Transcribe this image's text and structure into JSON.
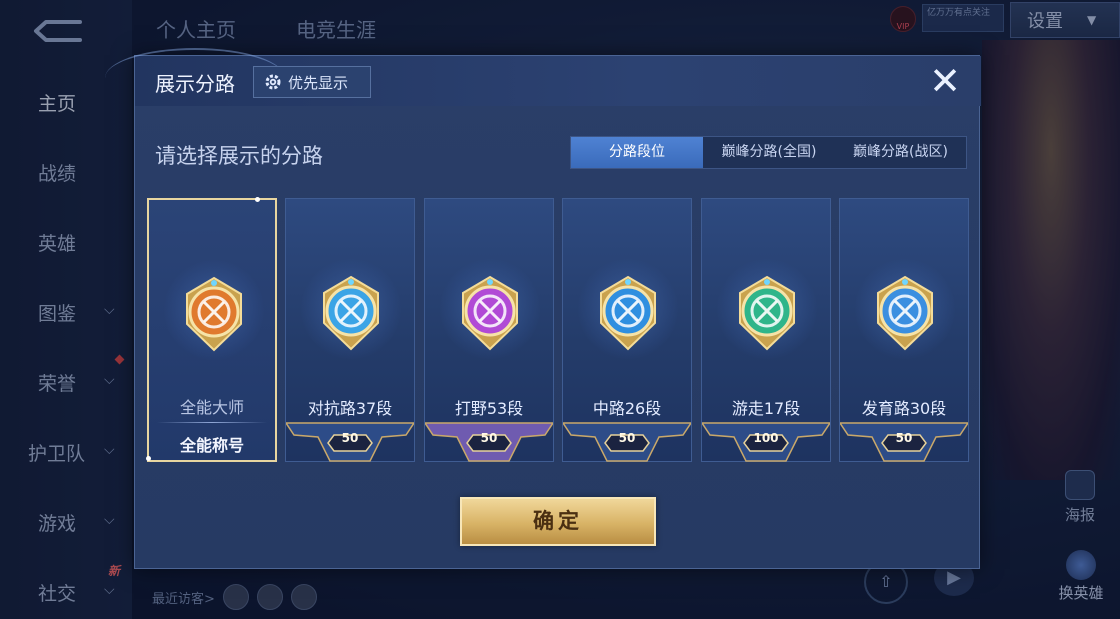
{
  "top_tabs": [
    "个人主页",
    "电竞生涯"
  ],
  "header": {
    "settings_label": "设置",
    "vip_label": "VIP",
    "vip_box_text": "亿万万有点关注"
  },
  "sidebar": {
    "items": [
      {
        "label": "主页",
        "has_chevron": false
      },
      {
        "label": "战绩",
        "has_chevron": false
      },
      {
        "label": "英雄",
        "has_chevron": false
      },
      {
        "label": "图鉴",
        "has_chevron": true
      },
      {
        "label": "荣誉",
        "has_chevron": true
      },
      {
        "label": "护卫队",
        "has_chevron": true
      },
      {
        "label": "游戏",
        "has_chevron": true
      },
      {
        "label": "社交",
        "has_chevron": true
      }
    ],
    "new_badge": "新"
  },
  "recent_visitors_label": "最近访客>",
  "right_panel": {
    "poster_label": "海报",
    "swap_hero_label": "换英雄"
  },
  "modal": {
    "title": "展示分路",
    "priority_button": "优先显示",
    "subtitle": "请选择展示的分路",
    "segments": [
      "分路段位",
      "巅峰分路(全国)",
      "巅峰分路(战区)"
    ],
    "active_segment": 0,
    "confirm_label": "确定",
    "cards": [
      {
        "label": "全能大师",
        "tag": "全能称号",
        "badge": "",
        "selected": true,
        "emblem": "all-round-emblem",
        "color": "#e07a2e"
      },
      {
        "label": "对抗路37段",
        "tag": "",
        "badge": "50",
        "selected": false,
        "emblem": "clash-lane-emblem",
        "color": "#3ba4e6"
      },
      {
        "label": "打野53段",
        "tag": "",
        "badge": "50",
        "selected": false,
        "emblem": "jungle-emblem",
        "color": "#b14ad6"
      },
      {
        "label": "中路26段",
        "tag": "",
        "badge": "50",
        "selected": false,
        "emblem": "mid-lane-emblem",
        "color": "#2f8fe0"
      },
      {
        "label": "游走17段",
        "tag": "",
        "badge": "100",
        "selected": false,
        "emblem": "roam-emblem",
        "color": "#2fb58a"
      },
      {
        "label": "发育路30段",
        "tag": "",
        "badge": "50",
        "selected": false,
        "emblem": "farm-lane-emblem",
        "color": "#3b8fe0"
      }
    ]
  }
}
